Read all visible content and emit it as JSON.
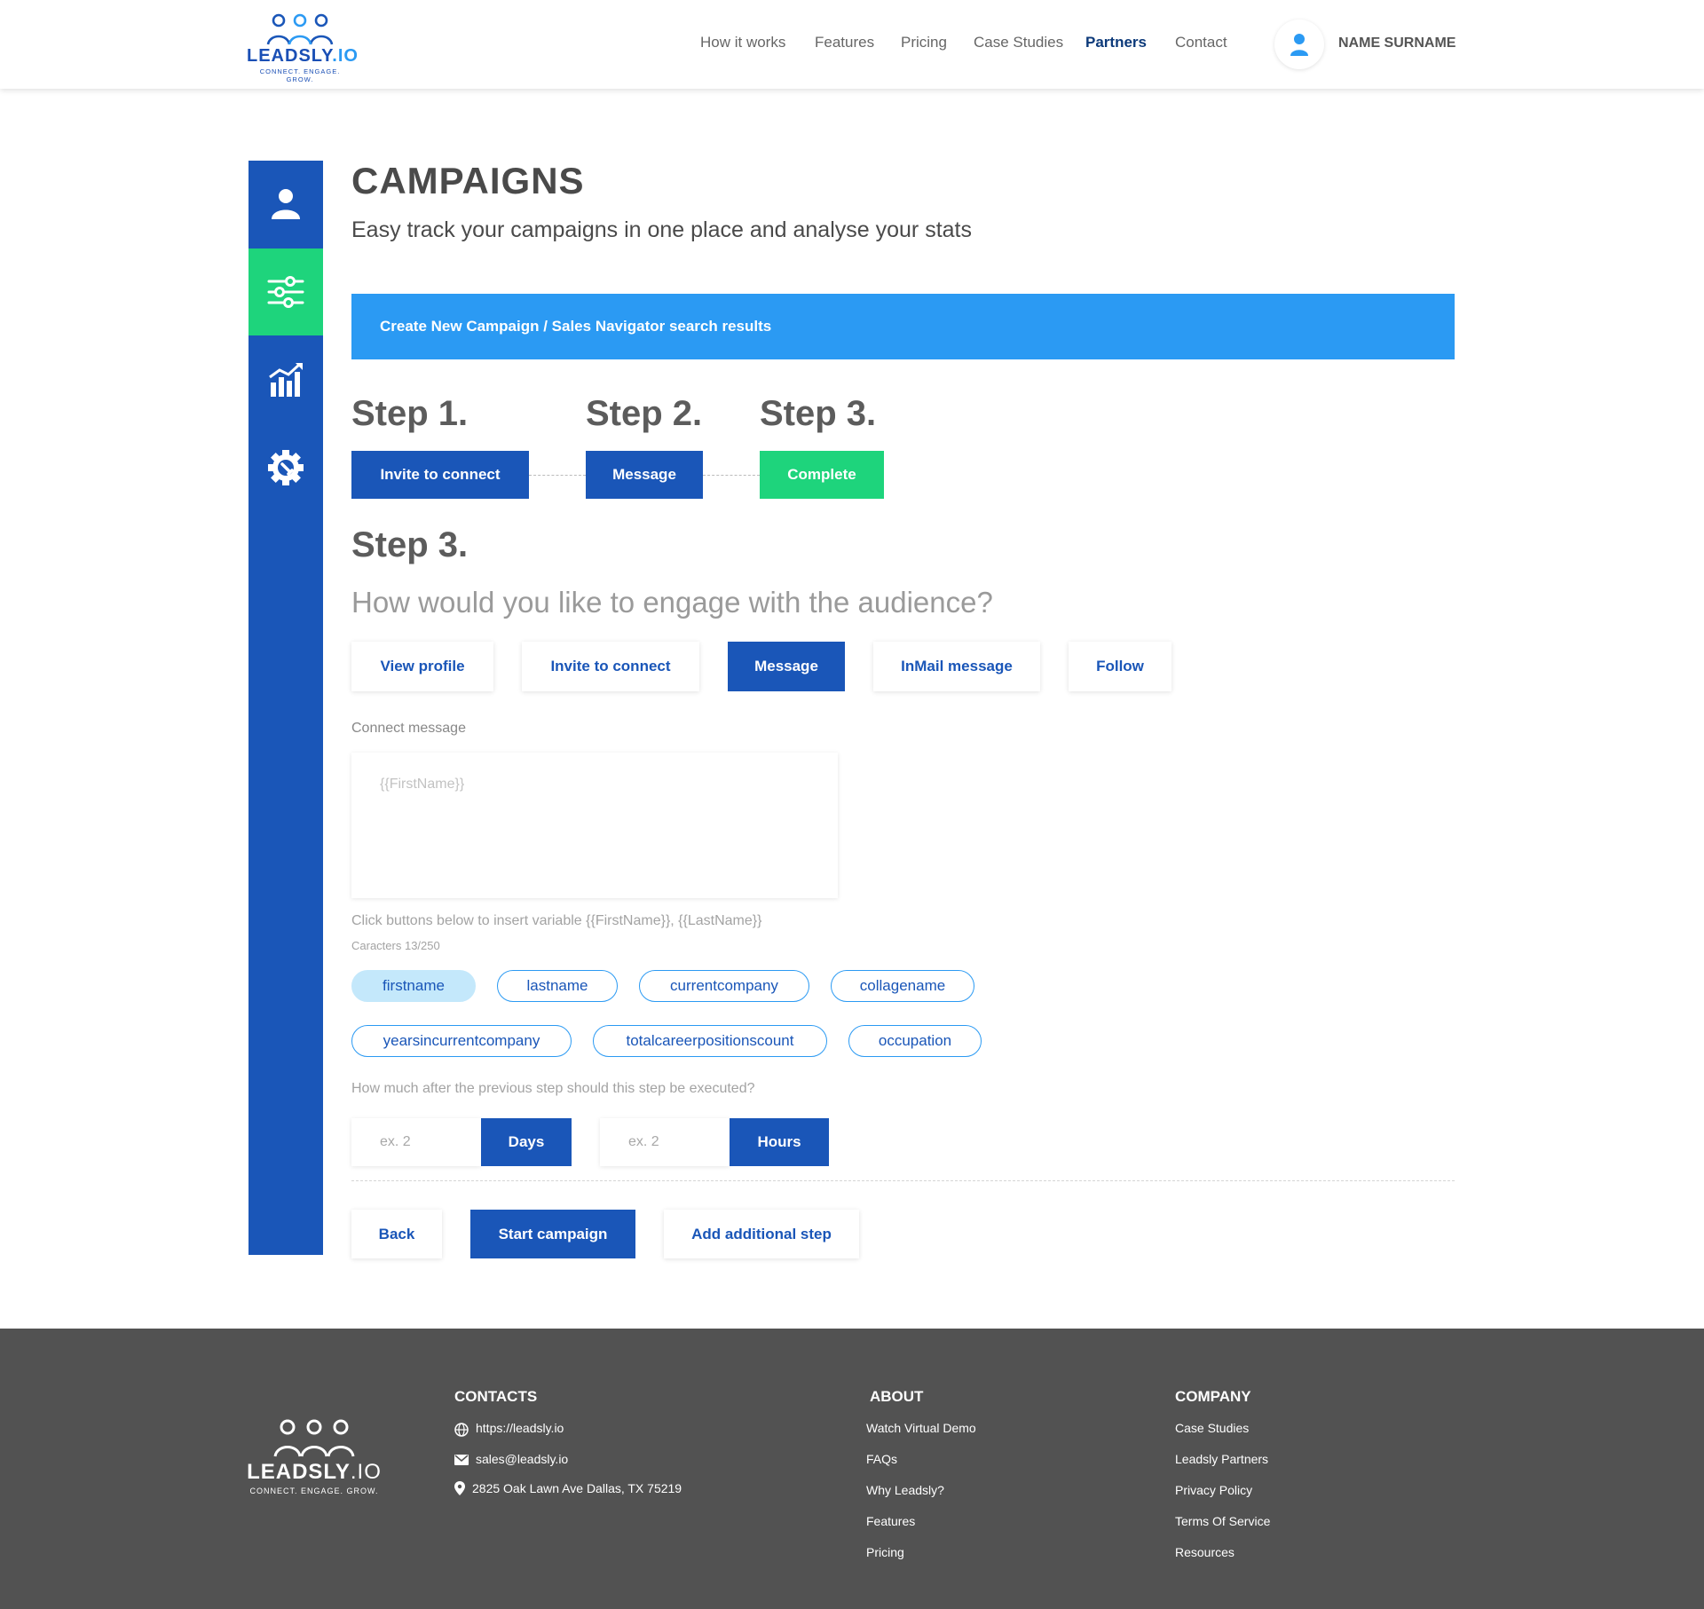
{
  "header": {
    "logo_text_main": "LEADSLY",
    "logo_text_suffix": ".IO",
    "logo_tagline": "CONNECT. ENGAGE. GROW.",
    "nav": [
      "How it works",
      "Features",
      "Pricing",
      "Case Studies",
      "Partners",
      "Contact"
    ],
    "active_nav": "Partners",
    "user_name": "NAME SURNAME"
  },
  "sidebar": {
    "items": [
      {
        "icon": "user-icon",
        "active": false
      },
      {
        "icon": "sliders-icon",
        "active": true
      },
      {
        "icon": "analytics-chart-icon",
        "active": false
      },
      {
        "icon": "settings-gear-icon",
        "active": false
      }
    ]
  },
  "main": {
    "title": "CAMPAIGNS",
    "subtitle": "Easy track your campaigns in one place and analyse your stats",
    "banner": "Create New Campaign / Sales Navigator search results",
    "steps": [
      {
        "label": "Step 1.",
        "button": "Invite to connect"
      },
      {
        "label": "Step 2.",
        "button": "Message"
      },
      {
        "label": "Step 3.",
        "button": "Complete"
      }
    ],
    "current_step_heading": "Step 3.",
    "question": "How would you like to engage with the audience?",
    "options": [
      "View profile",
      "Invite to connect",
      "Message",
      "InMail message",
      "Follow"
    ],
    "selected_option": "Message",
    "connect_message_label": "Connect message",
    "connect_message_placeholder": "{{FirstName}}",
    "variable_hint": "Click buttons below to insert variable {{FirstName}}, {{LastName}}",
    "char_counter": "Caracters 13/250",
    "variables": [
      "firstname",
      "lastname",
      "currentcompany",
      "collagename",
      "yearsincurrentcompany",
      "totalcareerpositionscount",
      "occupation"
    ],
    "selected_variable": "firstname",
    "delay_question": "How much after the previous step should this step be executed?",
    "days_placeholder": "ex. 2",
    "days_label": "Days",
    "hours_placeholder": "ex. 2",
    "hours_label": "Hours",
    "actions": {
      "back": "Back",
      "start": "Start campaign",
      "add_step": "Add additional step"
    }
  },
  "footer": {
    "logo_text_main": "LEADSLY",
    "logo_text_suffix": ".IO",
    "logo_tagline": "CONNECT. ENGAGE. GROW.",
    "contacts_heading": "CONTACTS",
    "website": "https://leadsly.io",
    "email": "sales@leadsly.io",
    "address": "2825 Oak Lawn Ave Dallas, TX 75219",
    "about_heading": "ABOUT",
    "about_links": [
      "Watch Virtual Demo",
      "FAQs",
      "Why Leadsly?",
      "Features",
      "Pricing"
    ],
    "company_heading": "COMPANY",
    "company_links": [
      "Case Studies",
      "Leadsly Partners",
      "Privacy Policy",
      "Terms Of Service",
      "Resources"
    ]
  },
  "colors": {
    "primary_blue": "#1a56b8",
    "accent_blue": "#2b9af3",
    "accent_green": "#1ed47c",
    "footer_bg": "#525252"
  }
}
